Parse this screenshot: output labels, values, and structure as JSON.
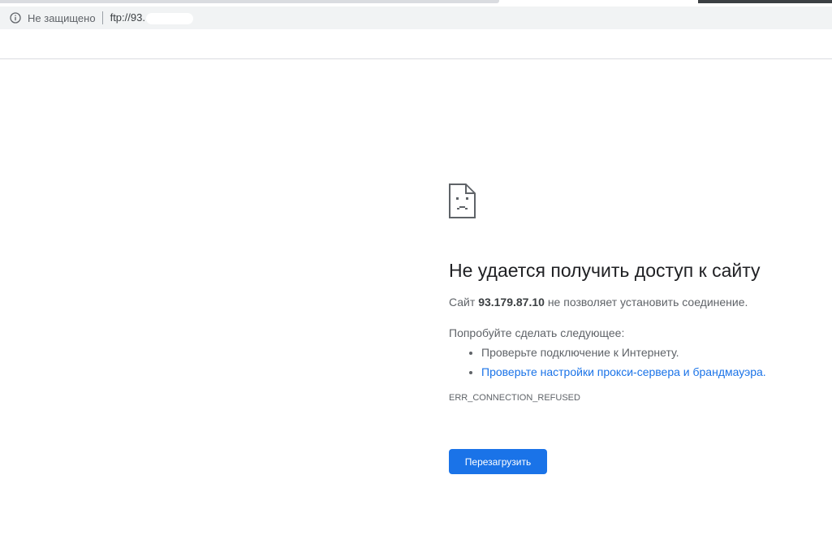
{
  "browser": {
    "security_label": "Не защищено",
    "url": "ftp://93.",
    "icons": {
      "info": "info-icon"
    }
  },
  "error_page": {
    "icon": "sad-document-icon",
    "title": "Не удается получить доступ к сайту",
    "description_prefix": "Сайт ",
    "host": "93.179.87.10",
    "description_suffix": " не позволяет установить соединение.",
    "suggestions_heading": "Попробуйте сделать следующее:",
    "suggestions": [
      {
        "text": "Проверьте подключение к Интернету."
      },
      {
        "text": "Проверьте настройки прокси-сервера и брандмауэра."
      }
    ],
    "error_code": "ERR_CONNECTION_REFUSED",
    "reload_label": "Перезагрузить"
  },
  "colors": {
    "accent": "#1a73e8",
    "text_primary": "#202124",
    "text_secondary": "#5f6368"
  }
}
